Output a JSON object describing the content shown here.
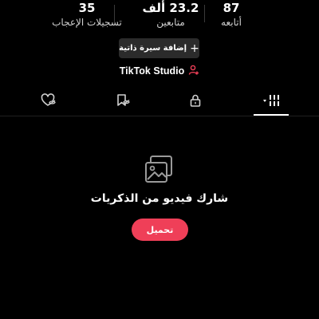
{
  "stats": {
    "following": {
      "value": "87",
      "label": "أتابعه"
    },
    "followers": {
      "value": "23.2 ألف",
      "label": "متابعين"
    },
    "likes": {
      "value": "35",
      "label": "تسجيلات الإعجاب"
    }
  },
  "bio_button": {
    "label": "إضافة سيرة ذاتية",
    "icon": "plus-icon"
  },
  "studio": {
    "label": "TikTok Studio",
    "icon": "person-add-icon",
    "accent": "#ef3f58"
  },
  "tabs": [
    {
      "icon": "grid-icon",
      "active": true
    },
    {
      "icon": "lock-icon",
      "active": false
    },
    {
      "icon": "bookmark-hidden-icon",
      "active": false
    },
    {
      "icon": "heart-hidden-icon",
      "active": false
    }
  ],
  "empty_state": {
    "icon": "photo-gallery-icon",
    "title": "شارك فيديو من الذكريات",
    "button_label": "تحميل"
  },
  "colors": {
    "background": "#000000",
    "accent": "#ef3f58",
    "chip": "#2b2b2b"
  }
}
